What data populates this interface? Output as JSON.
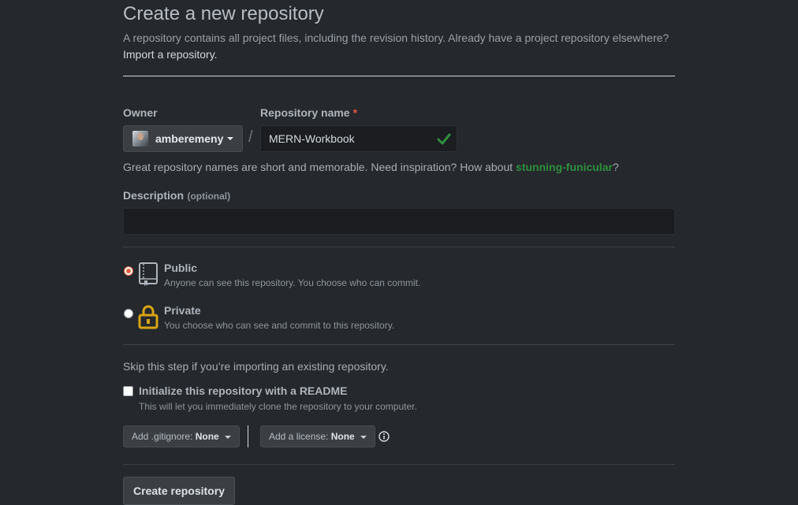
{
  "page": {
    "title": "Create a new repository",
    "description": "A repository contains all project files, including the revision history. Already have a project repository elsewhere?",
    "import_link": "Import a repository."
  },
  "owner": {
    "label": "Owner",
    "name": "amberemeny"
  },
  "separator": "/",
  "repository": {
    "label": "Repository name",
    "required_marker": "*",
    "value": "MERN-Workbook",
    "hint_prefix": "Great repository names are short and memorable. Need inspiration? How about",
    "suggestion": "stunning-funicular",
    "hint_suffix": "?"
  },
  "description": {
    "label": "Description",
    "optional": "(optional)",
    "value": ""
  },
  "visibility": {
    "selected": "public",
    "public": {
      "title": "Public",
      "note": "Anyone can see this repository. You choose who can commit."
    },
    "private": {
      "title": "Private",
      "note": "You choose who can see and commit to this repository."
    }
  },
  "init": {
    "skip_text": "Skip this step if you’re importing an existing repository.",
    "readme_label": "Initialize this repository with a README",
    "readme_note": "This will let you immediately clone the repository to your computer.",
    "readme_checked": false
  },
  "gitignore": {
    "prefix": "Add .gitignore:",
    "value": "None"
  },
  "license": {
    "prefix": "Add a license:",
    "value": "None"
  },
  "submit_label": "Create repository",
  "colors": {
    "background": "#25282c",
    "success": "#2f8f3d",
    "required": "#e5534b",
    "radio_accent": "#e5603b",
    "lock": "#d9a514"
  },
  "icons": [
    "chevron-down-icon",
    "check-icon",
    "repo-icon",
    "lock-icon",
    "info-icon"
  ]
}
